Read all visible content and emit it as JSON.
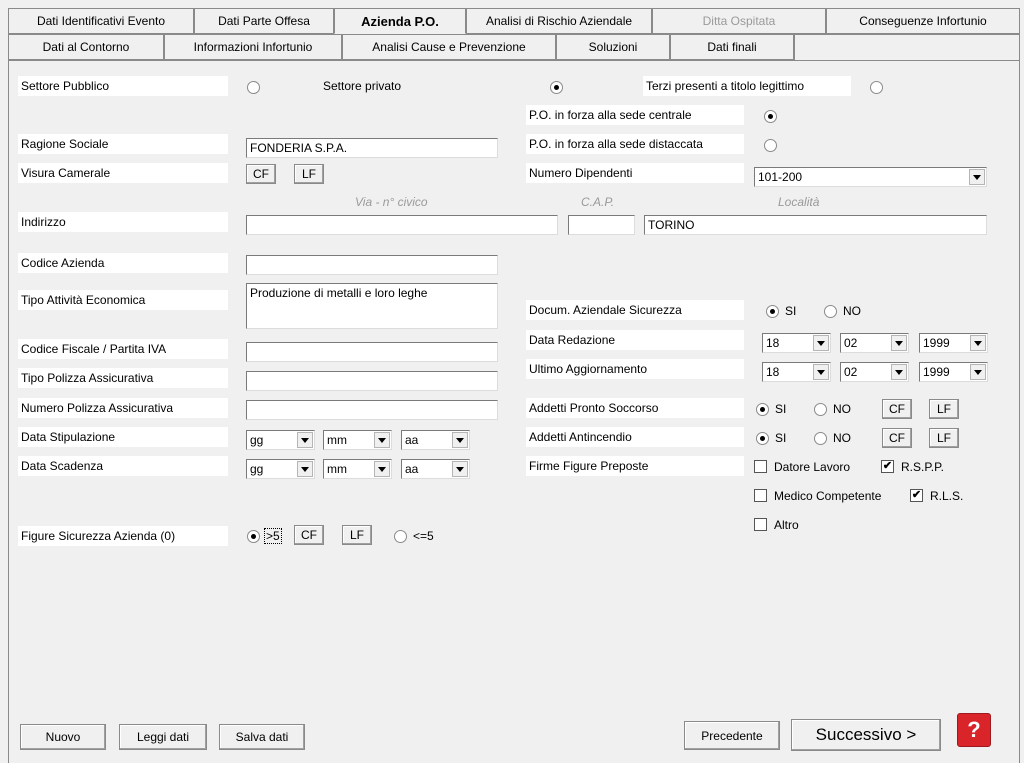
{
  "tabs_row1": [
    {
      "label": "Dati Identificativi Evento",
      "state": "normal"
    },
    {
      "label": "Dati Parte Offesa",
      "state": "normal"
    },
    {
      "label": "Azienda P.O.",
      "state": "active"
    },
    {
      "label": "Analisi di Rischio Aziendale",
      "state": "normal"
    },
    {
      "label": "Ditta Ospitata",
      "state": "disabled"
    },
    {
      "label": "Conseguenze Infortunio",
      "state": "normal"
    }
  ],
  "tabs_row2": [
    {
      "label": "Dati al Contorno"
    },
    {
      "label": "Informazioni Infortunio"
    },
    {
      "label": "Analisi Cause e Prevenzione"
    },
    {
      "label": "Soluzioni"
    },
    {
      "label": "Dati finali"
    }
  ],
  "sector": {
    "pubblico_label": "Settore Pubblico",
    "privato_label": "Settore privato",
    "terzi_label": "Terzi presenti a titolo legittimo",
    "selected": "privato"
  },
  "po": {
    "centrale_label": "P.O. in forza alla sede centrale",
    "distaccata_label": "P.O. in forza alla sede distaccata",
    "selected": "centrale"
  },
  "left_labels": {
    "ragione_sociale": "Ragione Sociale",
    "visura_camerale": "Visura Camerale",
    "indirizzo": "Indirizzo",
    "codice_azienda": "Codice Azienda",
    "tipo_attivita": "Tipo Attività Economica",
    "codice_fiscale": "Codice Fiscale / Partita IVA",
    "tipo_polizza": "Tipo Polizza Assicurativa",
    "numero_polizza": "Numero Polizza Assicurativa",
    "data_stipulazione": "Data Stipulazione",
    "data_scadenza": "Data Scadenza",
    "figure_sicurezza": "Figure Sicurezza Azienda (0)"
  },
  "values": {
    "ragione_sociale": "FONDERIA S.P.A.",
    "via": "",
    "cap": "",
    "localita": "TORINO",
    "codice_azienda": "",
    "tipo_attivita": "Produzione di metalli e loro leghe",
    "codice_fiscale": "",
    "tipo_polizza": "",
    "numero_polizza": ""
  },
  "address_hints": {
    "via": "Via - n° civico",
    "cap": "C.A.P.",
    "localita": "Località"
  },
  "buttons": {
    "cf": "CF",
    "lf": "LF",
    "nuovo": "Nuovo",
    "leggi": "Leggi dati",
    "salva": "Salva dati",
    "precedente": "Precedente",
    "successivo": "Successivo >"
  },
  "date_placeholders": {
    "gg": "gg",
    "mm": "mm",
    "aa": "aa"
  },
  "numero_dipendenti": {
    "label": "Numero Dipendenti",
    "value": "101-200"
  },
  "docum": {
    "label": "Docum. Aziendale Sicurezza",
    "si": "SI",
    "no": "NO",
    "selected": "si"
  },
  "data_redazione": {
    "label": "Data Redazione",
    "gg": "18",
    "mm": "02",
    "aa": "1999"
  },
  "ultimo_agg": {
    "label": "Ultimo Aggiornamento",
    "gg": "18",
    "mm": "02",
    "aa": "1999"
  },
  "pronto_soccorso": {
    "label": "Addetti Pronto Soccorso",
    "si": "SI",
    "no": "NO",
    "selected": "si"
  },
  "antincendio": {
    "label": "Addetti Antincendio",
    "si": "SI",
    "no": "NO",
    "selected": "si"
  },
  "firme": {
    "label": "Firme Figure Preposte",
    "datore": {
      "label": "Datore Lavoro",
      "checked": false
    },
    "rspp": {
      "label": "R.S.P.P.",
      "checked": true
    },
    "medico": {
      "label": "Medico Competente",
      "checked": false
    },
    "rls": {
      "label": "R.L.S.",
      "checked": true
    },
    "altro": {
      "label": "Altro",
      "checked": false
    }
  },
  "figure": {
    "gt5": ">5",
    "le5": "<=5",
    "selected": "gt5"
  },
  "help_glyph": "?",
  "check_glyph": "✔"
}
